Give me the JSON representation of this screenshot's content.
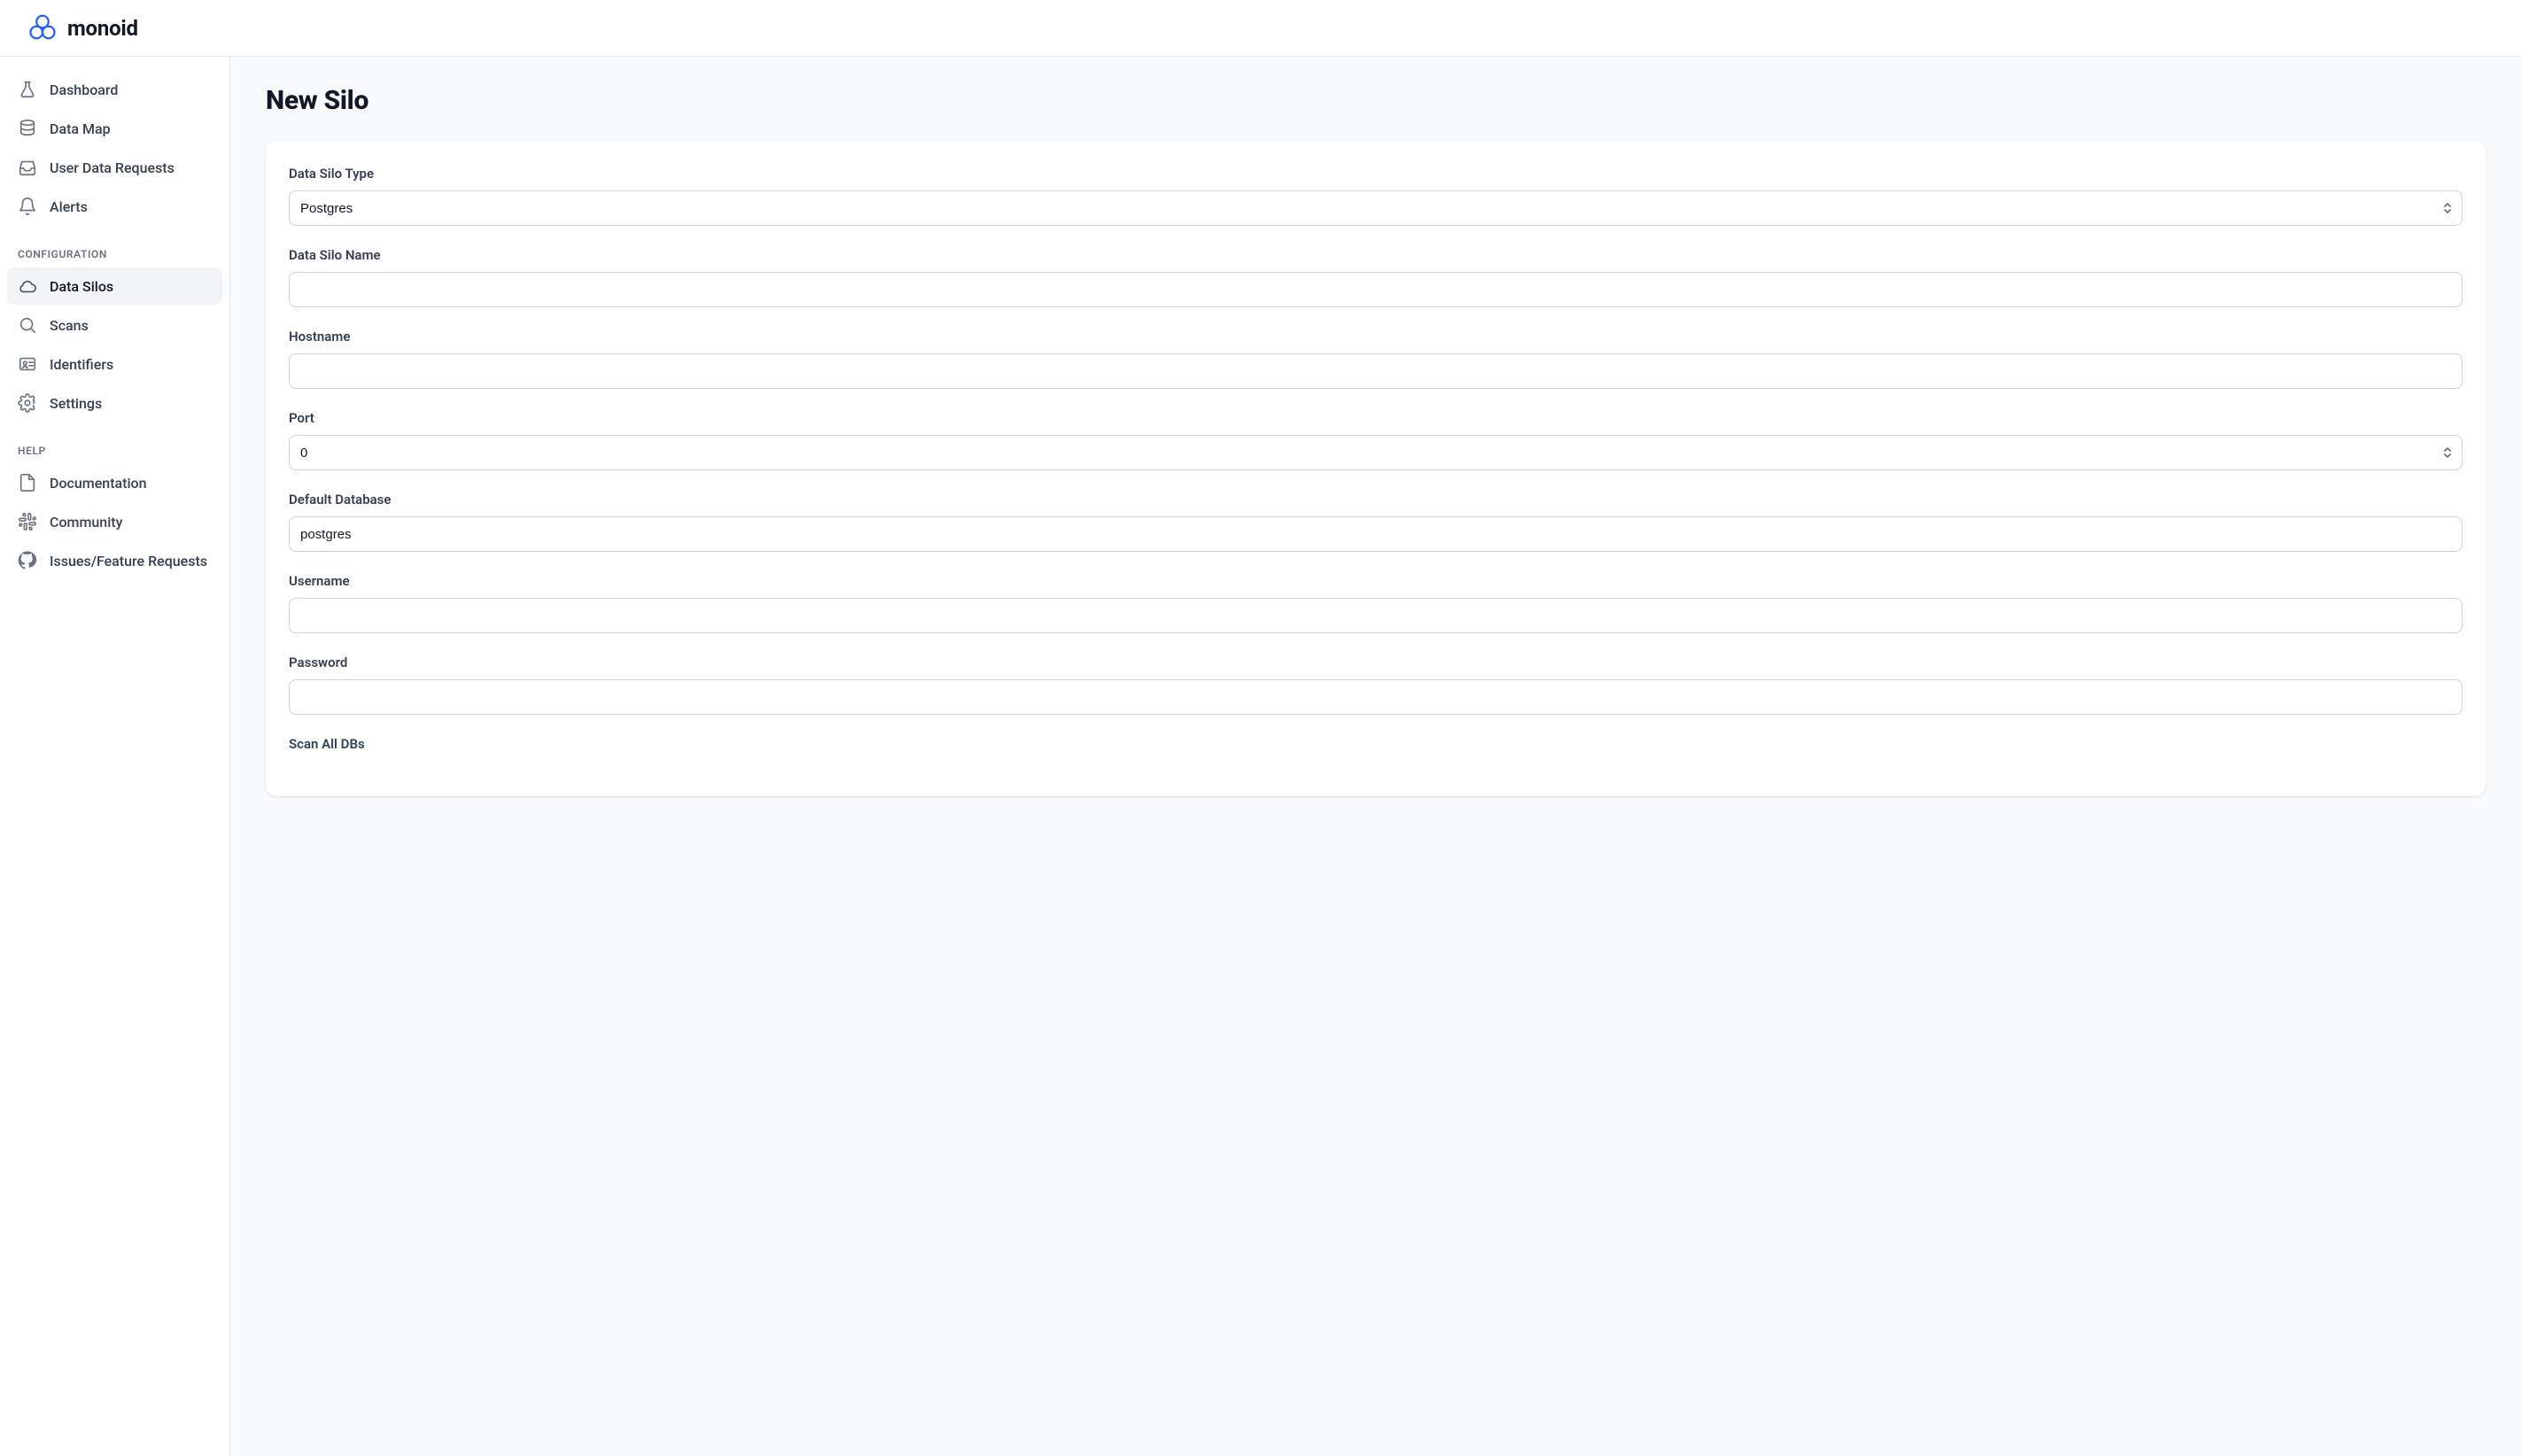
{
  "brand": {
    "name": "monoid"
  },
  "sidebar": {
    "sections": [
      {
        "label": null,
        "items": [
          {
            "label": "Dashboard"
          },
          {
            "label": "Data Map"
          },
          {
            "label": "User Data Requests"
          },
          {
            "label": "Alerts"
          }
        ]
      },
      {
        "label": "CONFIGURATION",
        "items": [
          {
            "label": "Data Silos"
          },
          {
            "label": "Scans"
          },
          {
            "label": "Identifiers"
          },
          {
            "label": "Settings"
          }
        ]
      },
      {
        "label": "HELP",
        "items": [
          {
            "label": "Documentation"
          },
          {
            "label": "Community"
          },
          {
            "label": "Issues/Feature Requests"
          }
        ]
      }
    ]
  },
  "page": {
    "title": "New Silo"
  },
  "form": {
    "silo_type": {
      "label": "Data Silo Type",
      "value": "Postgres"
    },
    "silo_name": {
      "label": "Data Silo Name",
      "value": ""
    },
    "hostname": {
      "label": "Hostname",
      "value": ""
    },
    "port": {
      "label": "Port",
      "value": "0"
    },
    "default_db": {
      "label": "Default Database",
      "value": "postgres"
    },
    "username": {
      "label": "Username",
      "value": ""
    },
    "password": {
      "label": "Password",
      "value": ""
    },
    "scan_all": {
      "label": "Scan All DBs"
    }
  }
}
